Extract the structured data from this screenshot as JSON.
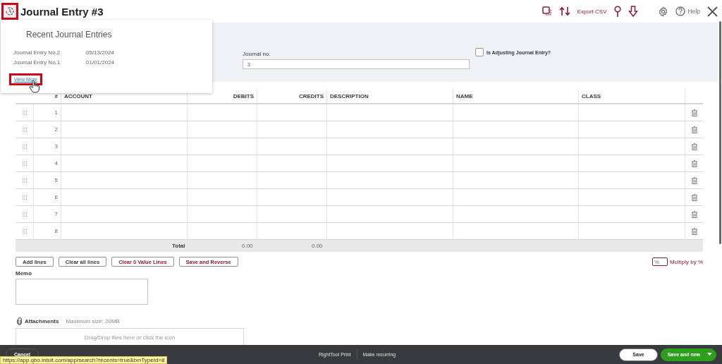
{
  "header": {
    "title": "Journal Entry #3",
    "history_button": {
      "highlighted": true
    },
    "export_label": "Export CSV",
    "help_label": "Help"
  },
  "recent_popup": {
    "title": "Recent Journal Entries",
    "entries": [
      {
        "name": "Journal Entry No.2",
        "date": "05/13/2024"
      },
      {
        "name": "Journal Entry No.1",
        "date": "01/01/2024"
      }
    ],
    "view_more": {
      "label": "View More",
      "highlighted": true
    }
  },
  "form": {
    "journal_no_label": "Journal no.",
    "journal_no_value": "3",
    "adjusting": {
      "label": "Is Adjusting Journal Entry?",
      "checked": false
    }
  },
  "table": {
    "columns": [
      "#",
      "ACCOUNT",
      "DEBITS",
      "CREDITS",
      "DESCRIPTION",
      "NAME",
      "CLASS"
    ],
    "rows": [
      "1",
      "2",
      "3",
      "4",
      "5",
      "6",
      "7",
      "8"
    ],
    "total": {
      "label": "Total",
      "debits": "0.00",
      "credits": "0.00"
    }
  },
  "line_buttons": [
    {
      "label": "Add lines",
      "kind": "plain"
    },
    {
      "label": "Clear all lines",
      "kind": "plain"
    },
    {
      "label": "Clear 0 Value Lines",
      "kind": "accent"
    },
    {
      "label": "Save and Reverse",
      "kind": "accent"
    }
  ],
  "multiply": {
    "placeholder": "%",
    "label": "Multiply by %"
  },
  "memo": {
    "label": "Memo"
  },
  "attachments": {
    "label": "Attachments",
    "max_size": "Maximum size: 20MB",
    "dropzone": "Drag/Drop files here or click the icon"
  },
  "footer": {
    "cancel": "Cancel",
    "links": [
      "RightTool Print",
      "Make recurring"
    ],
    "save": "Save",
    "save_and_new": "Save and new"
  },
  "status_url": "https://app.qbo.intuit.com/app/search?recents=true&txnTypeId=8"
}
